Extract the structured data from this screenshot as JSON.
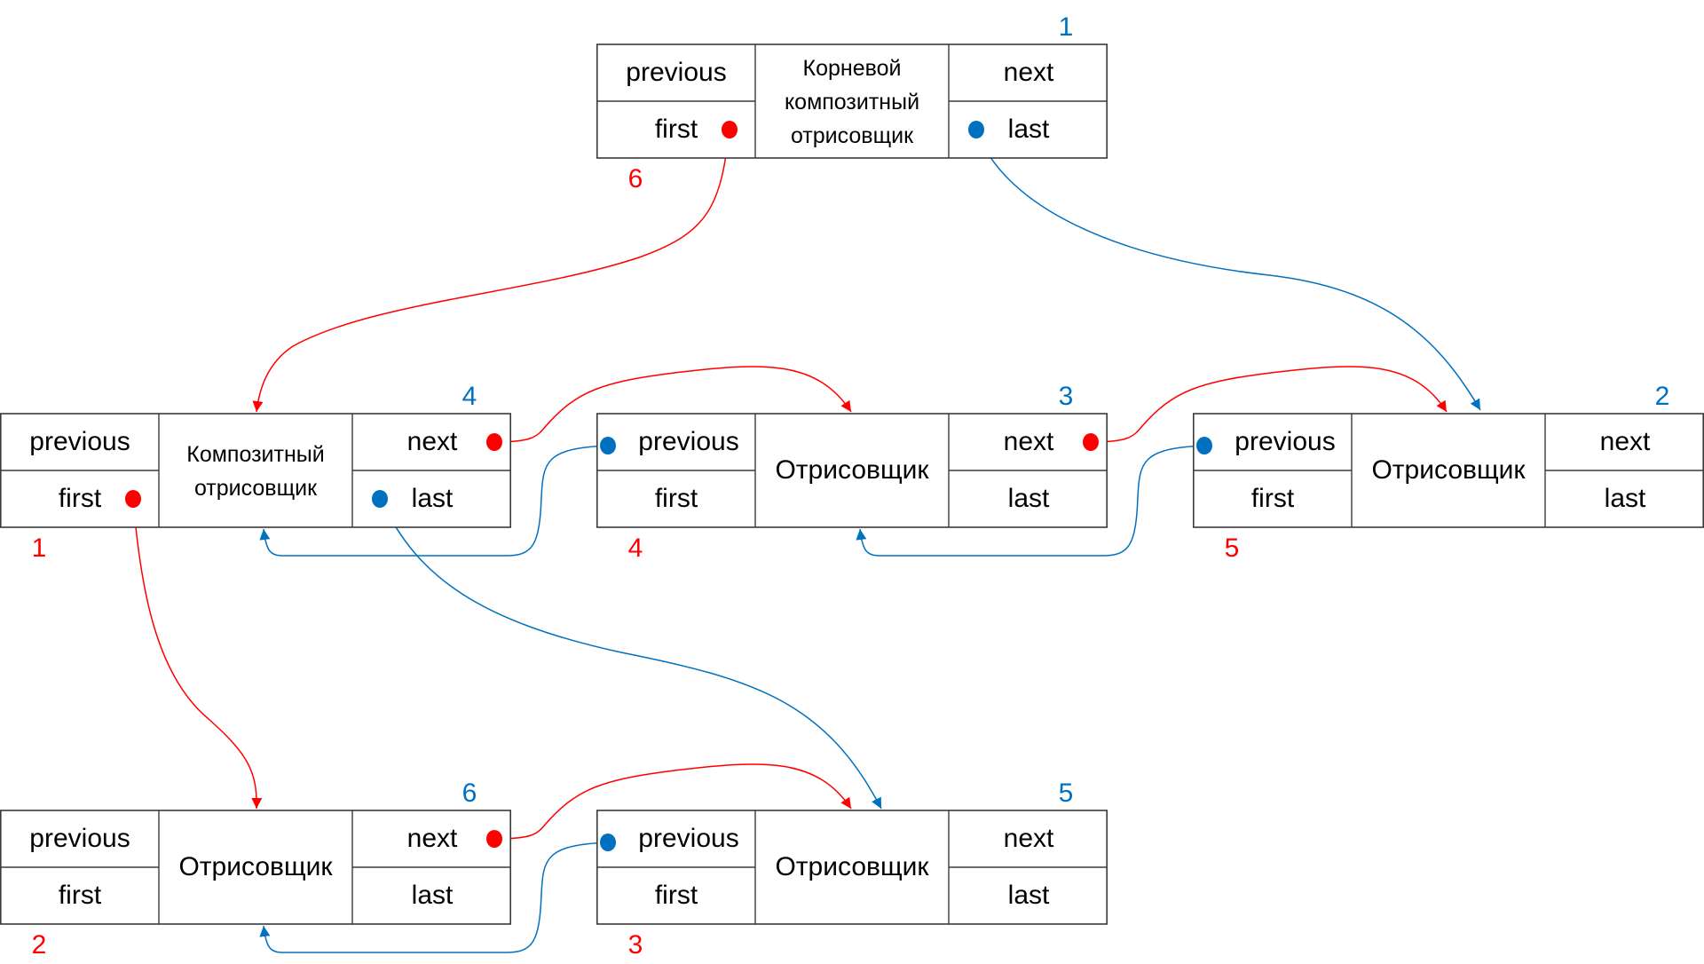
{
  "colors": {
    "red": "#FF0000",
    "blue": "#0070C0",
    "border": "#3A3A3A",
    "text": "#000000"
  },
  "fields": {
    "previous": "previous",
    "first": "first",
    "next": "next",
    "last": "last"
  },
  "nodes": [
    {
      "id": "root",
      "title_lines": [
        "Корневой",
        "композитный",
        "отрисовщик"
      ],
      "blue_label": "1",
      "red_label": "6",
      "pointers": [
        "first",
        "last"
      ]
    },
    {
      "id": "composite",
      "title_lines": [
        "Композитный",
        "отрисовщик"
      ],
      "blue_label": "4",
      "red_label": "1",
      "pointers": [
        "first",
        "last",
        "next"
      ]
    },
    {
      "id": "renderer-mid",
      "title_lines": [
        "Отрисовщик"
      ],
      "blue_label": "3",
      "red_label": "4",
      "pointers": [
        "previous",
        "next"
      ]
    },
    {
      "id": "renderer-right",
      "title_lines": [
        "Отрисовщик"
      ],
      "blue_label": "2",
      "red_label": "5",
      "pointers": [
        "previous"
      ]
    },
    {
      "id": "renderer-bottom-left",
      "title_lines": [
        "Отрисовщик"
      ],
      "blue_label": "6",
      "red_label": "2",
      "pointers": [
        "next"
      ]
    },
    {
      "id": "renderer-bottom-mid",
      "title_lines": [
        "Отрисовщик"
      ],
      "blue_label": "5",
      "red_label": "3",
      "pointers": [
        "previous"
      ]
    }
  ],
  "edges": [
    {
      "from": "root.first",
      "to": "composite",
      "color": "red"
    },
    {
      "from": "root.last",
      "to": "renderer-right",
      "color": "blue"
    },
    {
      "from": "composite.first",
      "to": "renderer-bottom-left",
      "color": "red"
    },
    {
      "from": "composite.last",
      "to": "renderer-bottom-mid",
      "color": "blue"
    },
    {
      "from": "composite.next",
      "to": "renderer-mid",
      "color": "red"
    },
    {
      "from": "renderer-mid.previous",
      "to": "composite",
      "color": "blue"
    },
    {
      "from": "renderer-mid.next",
      "to": "renderer-right",
      "color": "red"
    },
    {
      "from": "renderer-right.previous",
      "to": "renderer-mid",
      "color": "blue"
    },
    {
      "from": "renderer-bottom-left.next",
      "to": "renderer-bottom-mid",
      "color": "red"
    },
    {
      "from": "renderer-bottom-mid.previous",
      "to": "renderer-bottom-left",
      "color": "blue"
    }
  ]
}
